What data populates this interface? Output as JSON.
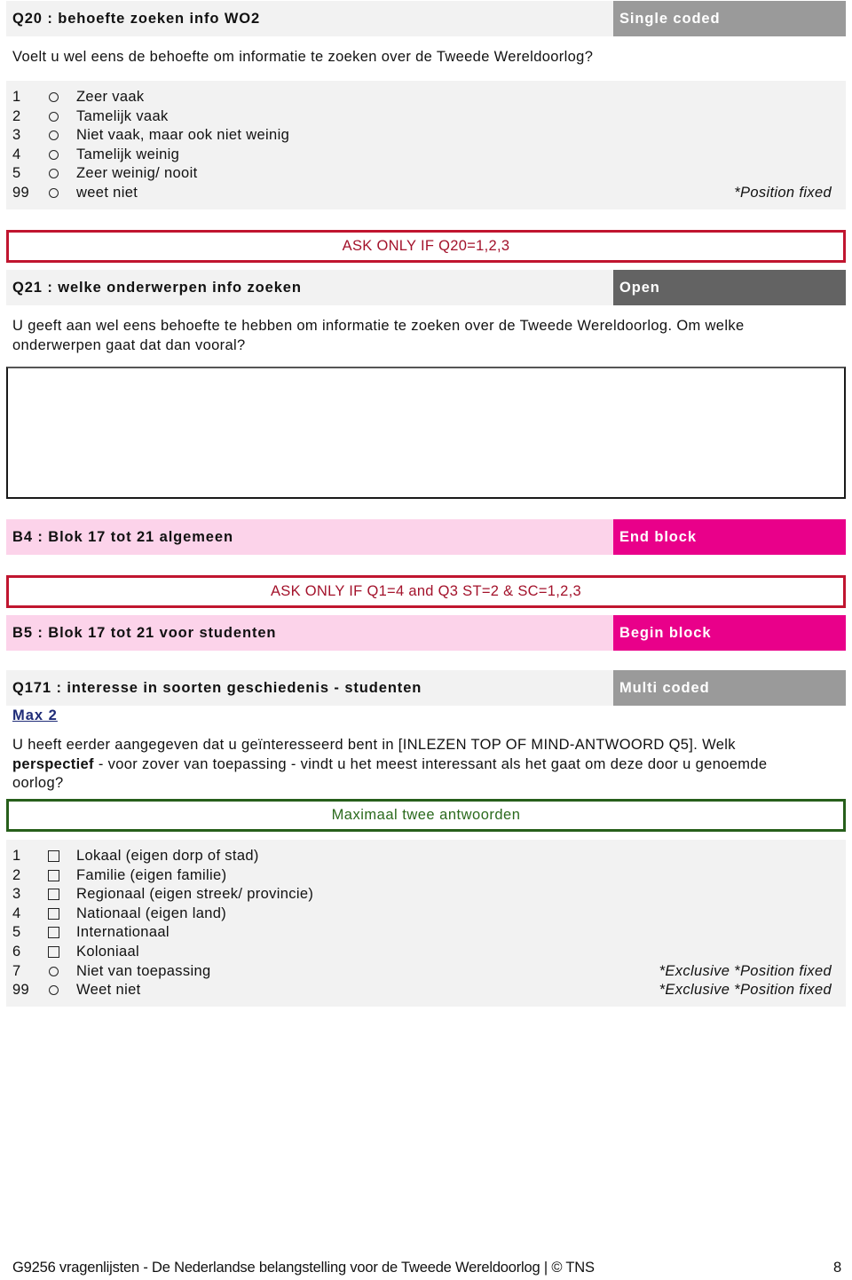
{
  "q20": {
    "title": "Q20 : behoefte zoeken info WO2",
    "type": "Single coded",
    "question": "Voelt u wel eens de behoefte om informatie te zoeken over de Tweede Wereldoorlog?",
    "answers": [
      {
        "code": "1",
        "icon": "radio-icon",
        "label": "Zeer vaak",
        "note": ""
      },
      {
        "code": "2",
        "icon": "radio-icon",
        "label": "Tamelijk vaak",
        "note": ""
      },
      {
        "code": "3",
        "icon": "radio-icon",
        "label": "Niet vaak, maar ook niet weinig",
        "note": ""
      },
      {
        "code": "4",
        "icon": "radio-icon",
        "label": "Tamelijk weinig",
        "note": ""
      },
      {
        "code": "5",
        "icon": "radio-icon",
        "label": "Zeer weinig/ nooit",
        "note": ""
      },
      {
        "code": "99",
        "icon": "radio-icon",
        "label": "weet niet",
        "note": "*Position fixed"
      }
    ]
  },
  "cond_q21": "ASK ONLY IF Q20=1,2,3",
  "q21": {
    "title": "Q21 : welke onderwerpen info zoeken",
    "type": "Open",
    "question": "U geeft aan wel eens behoefte te hebben om informatie te zoeken over de Tweede Wereldoorlog. Om welke onderwerpen gaat dat dan vooral?",
    "answer_value": ""
  },
  "b4": {
    "title": "B4 : Blok 17 tot 21 algemeen",
    "type": "End block"
  },
  "cond_b5": "ASK ONLY IF Q1=4 and Q3 ST=2 & SC=1,2,3",
  "b5": {
    "title": "B5 : Blok 17 tot 21 voor studenten",
    "type": "Begin block"
  },
  "q171": {
    "title": "Q171 : interesse in soorten geschiedenis - studenten",
    "type": "Multi coded",
    "max_link": "Max 2",
    "question_part1": "U heeft eerder aangegeven dat u geïnteresseerd bent in [INLEZEN TOP OF MIND-ANTWOORD Q5]. Welk ",
    "question_bold": "perspectief",
    "question_part2": " - voor zover van toepassing - vindt u het meest interessant als het gaat om deze door u genoemde oorlog?",
    "instruction": "Maximaal twee antwoorden",
    "answers": [
      {
        "code": "1",
        "icon": "checkbox-icon",
        "label": "Lokaal (eigen dorp of stad)",
        "note": ""
      },
      {
        "code": "2",
        "icon": "checkbox-icon",
        "label": "Familie (eigen familie)",
        "note": ""
      },
      {
        "code": "3",
        "icon": "checkbox-icon",
        "label": "Regionaal (eigen streek/ provincie)",
        "note": ""
      },
      {
        "code": "4",
        "icon": "checkbox-icon",
        "label": "Nationaal (eigen land)",
        "note": ""
      },
      {
        "code": "5",
        "icon": "checkbox-icon",
        "label": "Internationaal",
        "note": ""
      },
      {
        "code": "6",
        "icon": "checkbox-icon",
        "label": "Koloniaal",
        "note": ""
      },
      {
        "code": "7",
        "icon": "radio-icon",
        "label": "Niet van toepassing",
        "note": "*Exclusive *Position fixed"
      },
      {
        "code": "99",
        "icon": "radio-icon",
        "label": "Weet niet",
        "note": "*Exclusive *Position fixed"
      }
    ]
  },
  "footer": {
    "text": "G9256 vragenlijsten - De Nederlandse belangstelling voor de Tweede Wereldoorlog | © TNS",
    "page_number": "8"
  },
  "colors": {
    "single_coded": "#9a9a9a",
    "open": "#636363",
    "multi_coded": "#9a9a9a",
    "block_accent": "#e9008a",
    "block_bg": "#fcd3ea",
    "condition": "#c0152f",
    "instruction": "#275f1b",
    "link": "#1f2c78"
  }
}
